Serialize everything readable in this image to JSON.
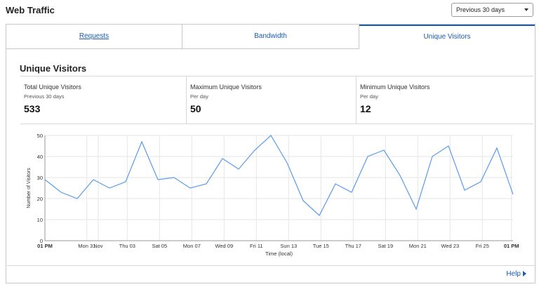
{
  "header": {
    "title": "Web Traffic"
  },
  "range_select": {
    "selected": "Previous 30 days"
  },
  "tabs": [
    {
      "label": "Requests",
      "active": false
    },
    {
      "label": "Bandwidth",
      "active": false
    },
    {
      "label": "Unique Visitors",
      "active": true
    }
  ],
  "section": {
    "title": "Unique Visitors"
  },
  "stats": [
    {
      "label": "Total Unique Visitors",
      "sub": "Previous 30 days",
      "value": "533"
    },
    {
      "label": "Maximum Unique Visitors",
      "sub": "Per day",
      "value": "50"
    },
    {
      "label": "Minimum Unique Visitors",
      "sub": "Per day",
      "value": "12"
    }
  ],
  "footer": {
    "help": "Help"
  },
  "colors": {
    "accent": "#1a5bb5",
    "line": "#5b9bea",
    "grid": "#e6e6e6"
  },
  "chart_data": {
    "type": "line",
    "xlabel": "Time (local)",
    "ylabel": "Number of Visitors",
    "ylim": [
      0,
      50
    ],
    "yticks": [
      0,
      10,
      20,
      30,
      40,
      50
    ],
    "grid": true,
    "x_tick_labels": [
      {
        "index": 0,
        "label": "01 PM",
        "bold": true
      },
      {
        "index": 2.6,
        "label": "Mon 31",
        "bold": false
      },
      {
        "index": 3.3,
        "label": "Nov",
        "bold": false
      },
      {
        "index": 5.1,
        "label": "Thu 03",
        "bold": false
      },
      {
        "index": 7.1,
        "label": "Sat 05",
        "bold": false
      },
      {
        "index": 9.1,
        "label": "Mon 07",
        "bold": false
      },
      {
        "index": 11.1,
        "label": "Wed 09",
        "bold": false
      },
      {
        "index": 13.1,
        "label": "Fri 11",
        "bold": false
      },
      {
        "index": 15.1,
        "label": "Sun 13",
        "bold": false
      },
      {
        "index": 17.1,
        "label": "Tue 15",
        "bold": false
      },
      {
        "index": 19.1,
        "label": "Thu 17",
        "bold": false
      },
      {
        "index": 21.1,
        "label": "Sat 19",
        "bold": false
      },
      {
        "index": 23.1,
        "label": "Mon 21",
        "bold": false
      },
      {
        "index": 25.1,
        "label": "Wed 23",
        "bold": false
      },
      {
        "index": 27.1,
        "label": "Fri 25",
        "bold": false
      },
      {
        "index": 28.9,
        "label": "01 PM",
        "bold": true
      }
    ],
    "series": [
      {
        "values": [
          29,
          23,
          20,
          29,
          25,
          28,
          47,
          29,
          30,
          25,
          27,
          39,
          34,
          43,
          50,
          37,
          19,
          12,
          27,
          23,
          40,
          43,
          31,
          15,
          40,
          45,
          24,
          28,
          44,
          22
        ]
      }
    ]
  }
}
